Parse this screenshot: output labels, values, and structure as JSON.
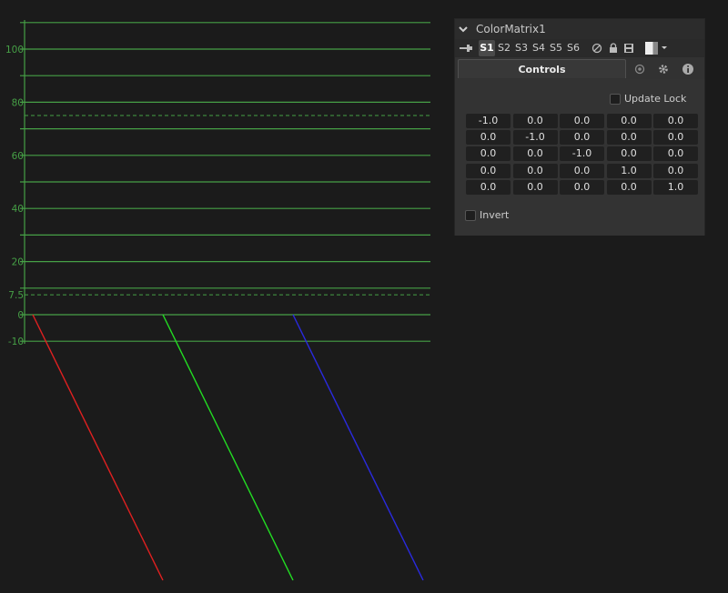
{
  "colors": {
    "graticule": "#46a046",
    "red_trace": "#e02020",
    "green_trace": "#22dd22",
    "blue_trace": "#2a2ae0",
    "panel_bg": "#323232"
  },
  "scope": {
    "type": "waveform",
    "scale_labels": [
      "100",
      "80",
      "60",
      "40",
      "20",
      "7.5",
      "0",
      "-10"
    ],
    "traces": [
      "red",
      "green",
      "blue"
    ]
  },
  "panel": {
    "title": "ColorMatrix1",
    "slots": [
      "S1",
      "S2",
      "S3",
      "S4",
      "S5",
      "S6"
    ],
    "active_slot": "S1",
    "icons": [
      "pin-icon",
      "disable-icon",
      "lock-icon",
      "save-icon",
      "color-swatch",
      "camera-icon",
      "gear-icon",
      "info-icon"
    ],
    "tabs": {
      "controls_label": "Controls"
    },
    "update_lock_label": "Update Lock",
    "matrix": [
      [
        "-1.0",
        "0.0",
        "0.0",
        "0.0",
        "0.0"
      ],
      [
        "0.0",
        "-1.0",
        "0.0",
        "0.0",
        "0.0"
      ],
      [
        "0.0",
        "0.0",
        "-1.0",
        "0.0",
        "0.0"
      ],
      [
        "0.0",
        "0.0",
        "0.0",
        "1.0",
        "0.0"
      ],
      [
        "0.0",
        "0.0",
        "0.0",
        "0.0",
        "1.0"
      ]
    ],
    "invert_label": "Invert"
  }
}
